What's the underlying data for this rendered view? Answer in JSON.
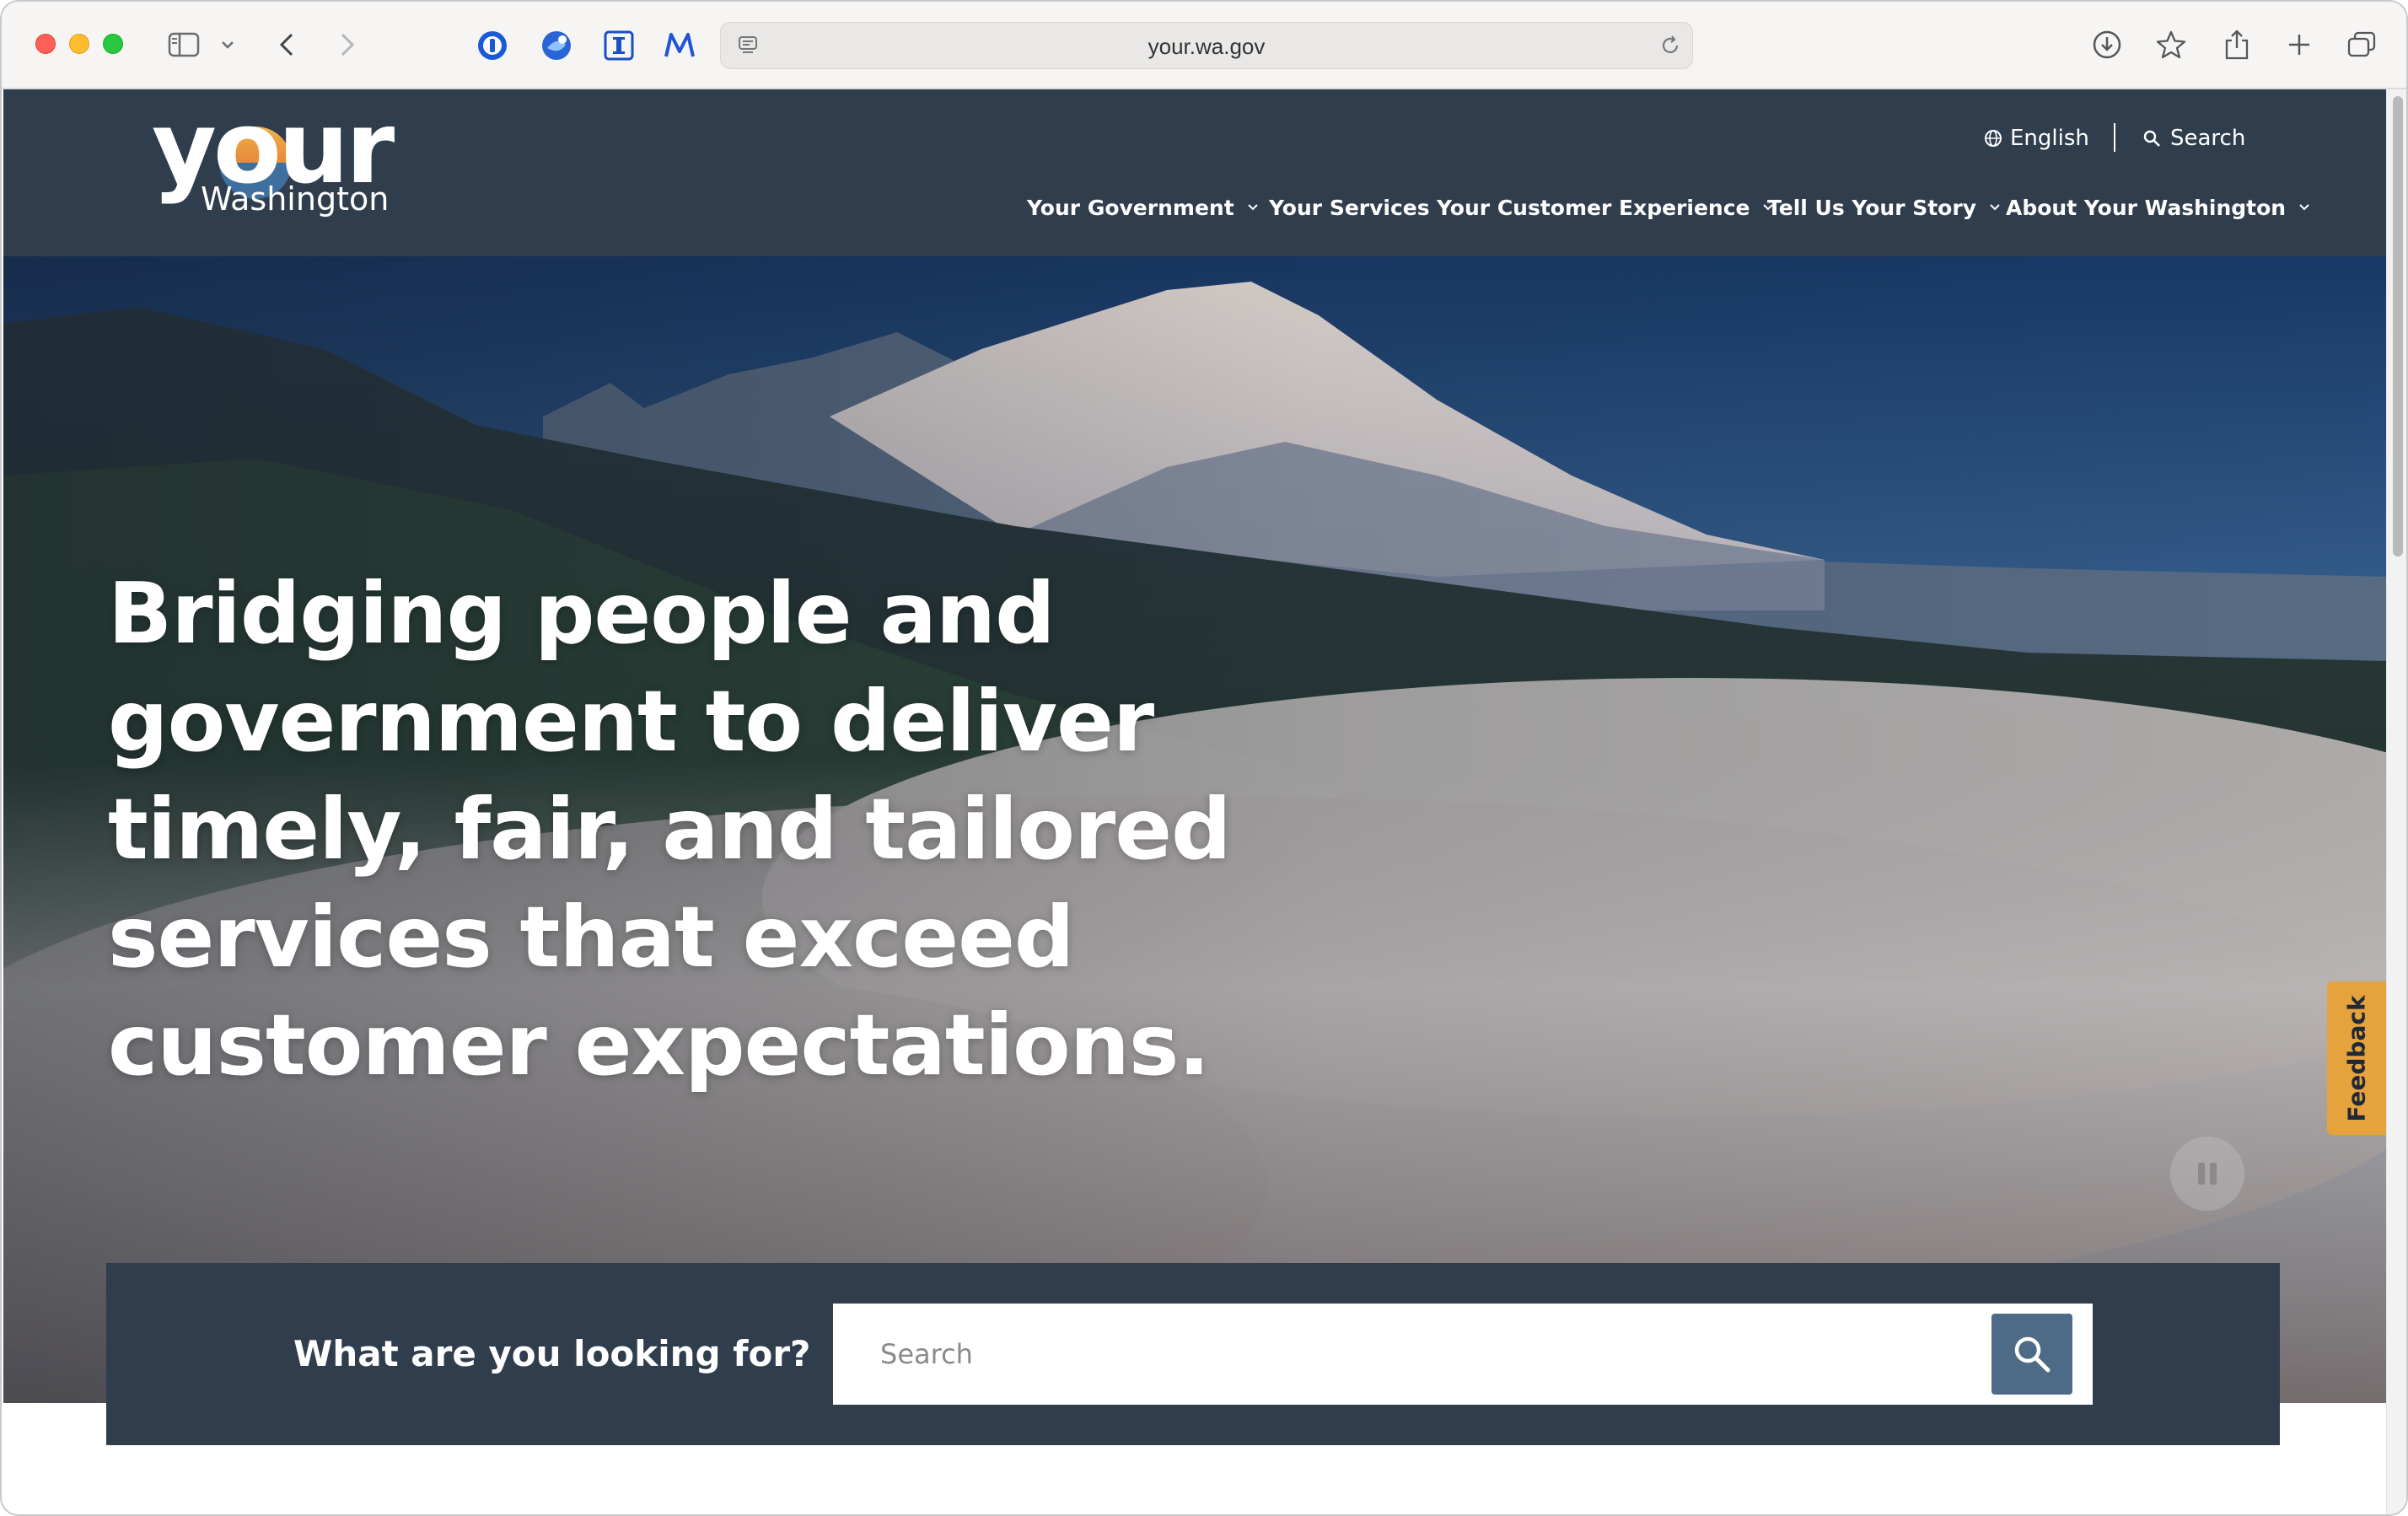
{
  "browser": {
    "url": "your.wa.gov"
  },
  "header": {
    "logo_your": "your",
    "logo_washington": "Washington",
    "language": "English",
    "search": "Search",
    "nav": [
      {
        "label": "Your Government"
      },
      {
        "label": "Your Services"
      },
      {
        "label": "Your Customer Experience"
      },
      {
        "label": "Tell Us Your Story"
      },
      {
        "label": "About Your Washington"
      }
    ]
  },
  "hero": {
    "headline": "Bridging people and government to deliver timely, fair, and tailored services that exceed customer expectations."
  },
  "feedback": {
    "label": "Feedback"
  },
  "search_band": {
    "question": "What are you looking for?",
    "placeholder": "Search"
  },
  "colors": {
    "header_bg": "#2f3d4d",
    "search_button": "#4d6b86",
    "feedback_tab": "#e6a23c"
  }
}
